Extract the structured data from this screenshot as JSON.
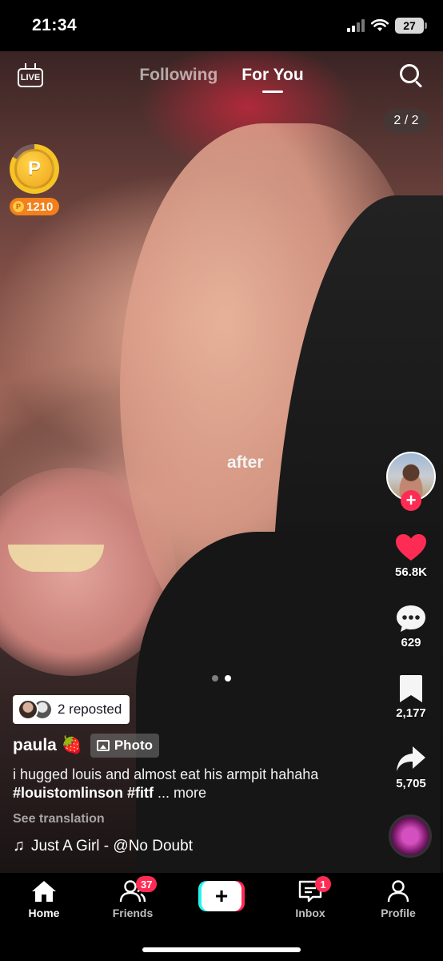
{
  "status_bar": {
    "time": "21:34",
    "battery": "27"
  },
  "top_nav": {
    "live_label": "LIVE",
    "tabs": [
      {
        "label": "Following",
        "active": false
      },
      {
        "label": "For You",
        "active": true
      }
    ],
    "page_counter": "2 / 2"
  },
  "coins": {
    "symbol": "P",
    "count": "1210",
    "progress": 0.83
  },
  "post": {
    "overlay_text": "after",
    "carousel": {
      "total": 2,
      "active": 2
    },
    "repost_text": "2 reposted",
    "username": "paula 🍓",
    "type_tag": "Photo",
    "caption_text": "i hugged louis and almost eat his armpit hahaha ",
    "hashtags": "#louistomlinson #fitf",
    "more_label": " ... more",
    "see_translation": "See translation",
    "sound": "Just A Girl - @No Doubt"
  },
  "actions": {
    "follow_plus": "+",
    "likes": "56.8K",
    "comments": "629",
    "bookmarks": "2,177",
    "shares": "5,705"
  },
  "colors": {
    "accent": "#fe2c55",
    "cyan": "#25f4ee",
    "coin": "#f2801b"
  },
  "bottom_nav": {
    "home": "Home",
    "friends": "Friends",
    "friends_badge": "37",
    "create": "+",
    "inbox": "Inbox",
    "inbox_badge": "1",
    "profile": "Profile"
  }
}
